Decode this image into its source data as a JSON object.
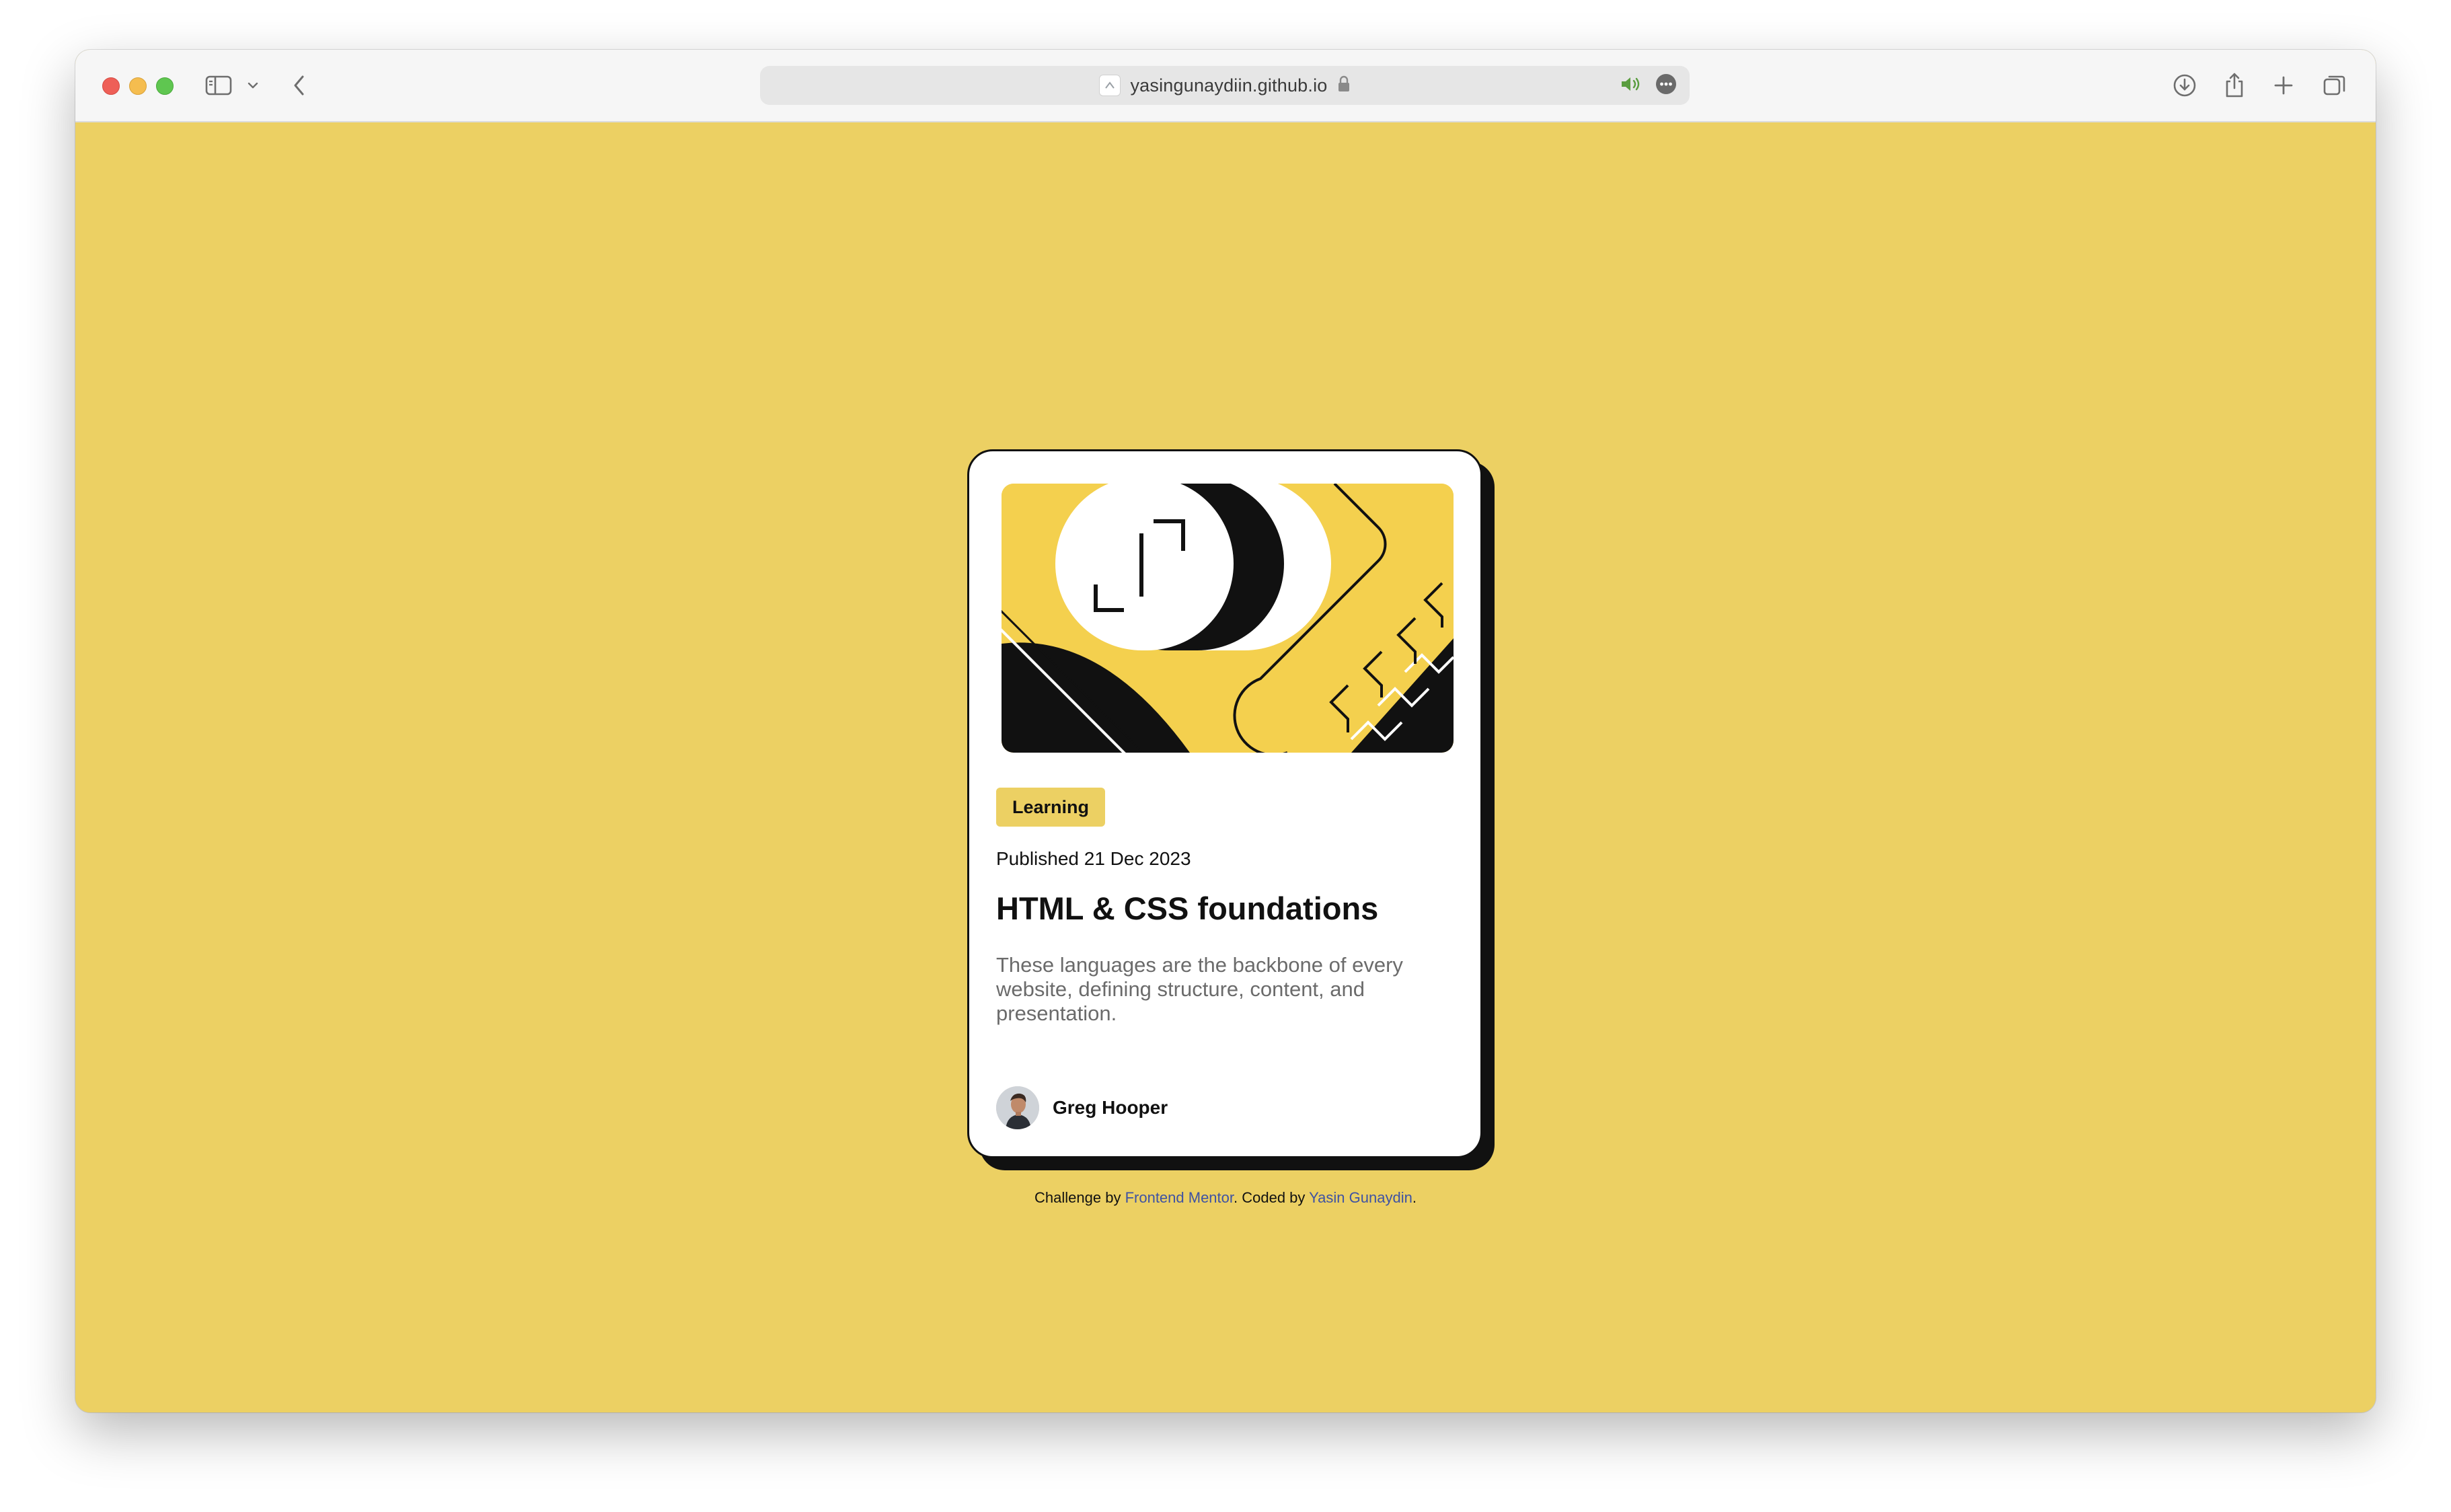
{
  "browser": {
    "url": "yasingunaydiin.github.io",
    "icons": {
      "sidebar": "sidebar-icon",
      "back": "chevron-left-icon",
      "audio": "speaker-icon",
      "more": "ellipsis-icon",
      "download": "download-icon",
      "share": "share-icon",
      "new_tab": "plus-icon",
      "tabs": "tab-overview-icon"
    }
  },
  "page": {
    "background": "#ecd063",
    "card": {
      "tag": "Learning",
      "published": "Published 21 Dec 2023",
      "title": "HTML & CSS foundations",
      "description": "These languages are the backbone of every website, defining structure, content, and presentation.",
      "author": "Greg Hooper"
    },
    "attribution": {
      "prefix": "Challenge by ",
      "link1": "Frontend Mentor",
      "middle": ". Coded by ",
      "link2": "Yasin Gunaydin",
      "suffix": "."
    }
  }
}
